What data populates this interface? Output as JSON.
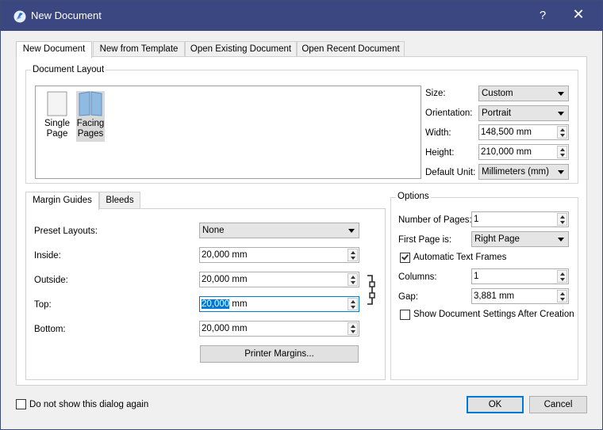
{
  "window": {
    "title": "New Document",
    "help_label": "?",
    "close_label": "✕"
  },
  "tabs": [
    {
      "label": "New Document",
      "active": true
    },
    {
      "label": "New from Template",
      "active": false
    },
    {
      "label": "Open Existing Document",
      "active": false
    },
    {
      "label": "Open Recent Document",
      "active": false
    }
  ],
  "document_layout": {
    "title": "Document Layout",
    "options": [
      {
        "label": "Single Page",
        "line1": "Single",
        "line2": "Page",
        "selected": false
      },
      {
        "label": "Facing Pages",
        "line1": "Facing",
        "line2": "Pages",
        "selected": true
      }
    ],
    "size": {
      "label": "Size:",
      "value": "Custom"
    },
    "orientation": {
      "label": "Orientation:",
      "value": "Portrait"
    },
    "width": {
      "label": "Width:",
      "value": "148,500 mm"
    },
    "height": {
      "label": "Height:",
      "value": "210,000 mm"
    },
    "default_unit": {
      "label": "Default Unit:",
      "value": "Millimeters (mm)"
    }
  },
  "margins": {
    "tabs": [
      {
        "label": "Margin Guides",
        "active": true
      },
      {
        "label": "Bleeds",
        "active": false
      }
    ],
    "preset": {
      "label": "Preset Layouts:",
      "value": "None"
    },
    "inside": {
      "label": "Inside:",
      "value": "20,000 mm"
    },
    "outside": {
      "label": "Outside:",
      "value": "20,000 mm"
    },
    "top": {
      "label": "Top:",
      "value_selected": "20,000",
      "value_rest": " mm"
    },
    "bottom": {
      "label": "Bottom:",
      "value": "20,000 mm"
    },
    "printer_margins_label": "Printer Margins..."
  },
  "options": {
    "title": "Options",
    "num_pages": {
      "label": "Number of Pages:",
      "value": "1"
    },
    "first_page": {
      "label": "First Page is:",
      "value": "Right Page"
    },
    "auto_text_frames": {
      "label": "Automatic Text Frames",
      "checked": true
    },
    "columns": {
      "label": "Columns:",
      "value": "1"
    },
    "gap": {
      "label": "Gap:",
      "value": "3,881 mm"
    },
    "show_settings": {
      "label": "Show Document Settings After Creation",
      "checked": false
    }
  },
  "footer": {
    "dont_show": {
      "label": "Do not show this dialog again",
      "checked": false
    },
    "ok_label": "OK",
    "cancel_label": "Cancel"
  },
  "colors": {
    "titlebar": "#3a4780",
    "accent": "#0078d7",
    "dialog_bg": "#f0f0f0"
  }
}
